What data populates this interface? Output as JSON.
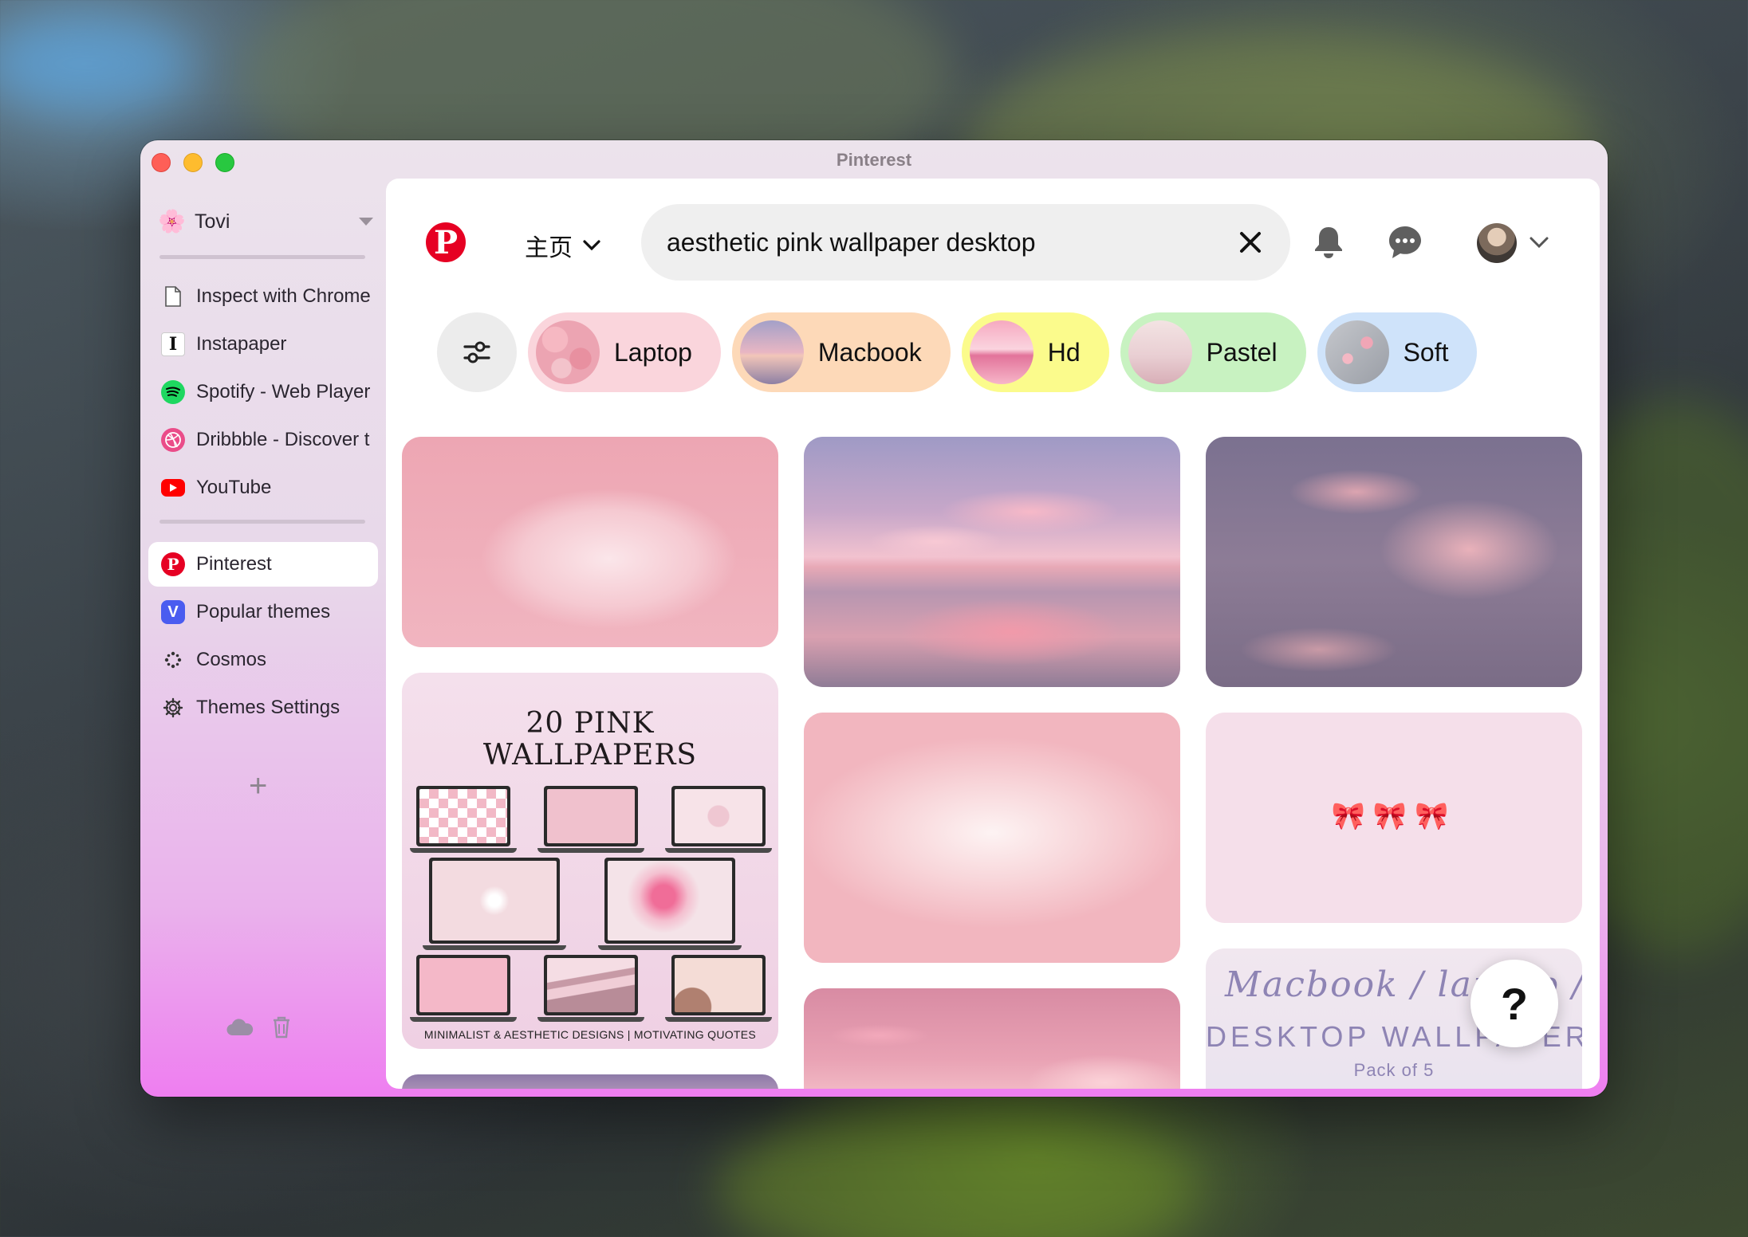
{
  "window": {
    "title": "Pinterest"
  },
  "sidebar": {
    "profile_name": "Tovi",
    "pinned": [
      {
        "label": "Inspect with Chrome",
        "icon": "document-icon"
      },
      {
        "label": "Instapaper",
        "icon": "instapaper-icon"
      },
      {
        "label": "Spotify - Web Player",
        "icon": "spotify-icon"
      },
      {
        "label": "Dribbble - Discover t",
        "icon": "dribbble-icon"
      },
      {
        "label": "YouTube",
        "icon": "youtube-icon"
      }
    ],
    "tabs": [
      {
        "label": "Pinterest",
        "icon": "pinterest-icon",
        "active": true
      },
      {
        "label": "Popular themes",
        "icon": "vivaldi-icon"
      },
      {
        "label": "Cosmos",
        "icon": "cosmos-icon"
      },
      {
        "label": "Themes Settings",
        "icon": "gear-icon"
      }
    ],
    "add_symbol": "+"
  },
  "header": {
    "home_label": "主页",
    "search_value": "aesthetic pink wallpaper desktop",
    "accent": "#e60023"
  },
  "chips": [
    {
      "label": "Laptop",
      "bg": "#fad5dc"
    },
    {
      "label": "Macbook",
      "bg": "#fdd9b8"
    },
    {
      "label": "Hd",
      "bg": "#fbfb8c"
    },
    {
      "label": "Pastel",
      "bg": "#c8f2c1"
    },
    {
      "label": "Soft",
      "bg": "#cfe3fa"
    }
  ],
  "pins": {
    "wallpapers_title_line1": "20 PINK",
    "wallpapers_title_line2": "WALLPAPERS",
    "wallpapers_footer": "MINIMALIST & AESTHETIC DESIGNS | MOTIVATING QUOTES",
    "desktop_script": "Macbook / laptop / d",
    "desktop_title": "DESKTOP WALLPAPER",
    "desktop_sub": "Pack of 5",
    "bows_glyphs": "🎀🎀🎀"
  },
  "help_label": "?"
}
